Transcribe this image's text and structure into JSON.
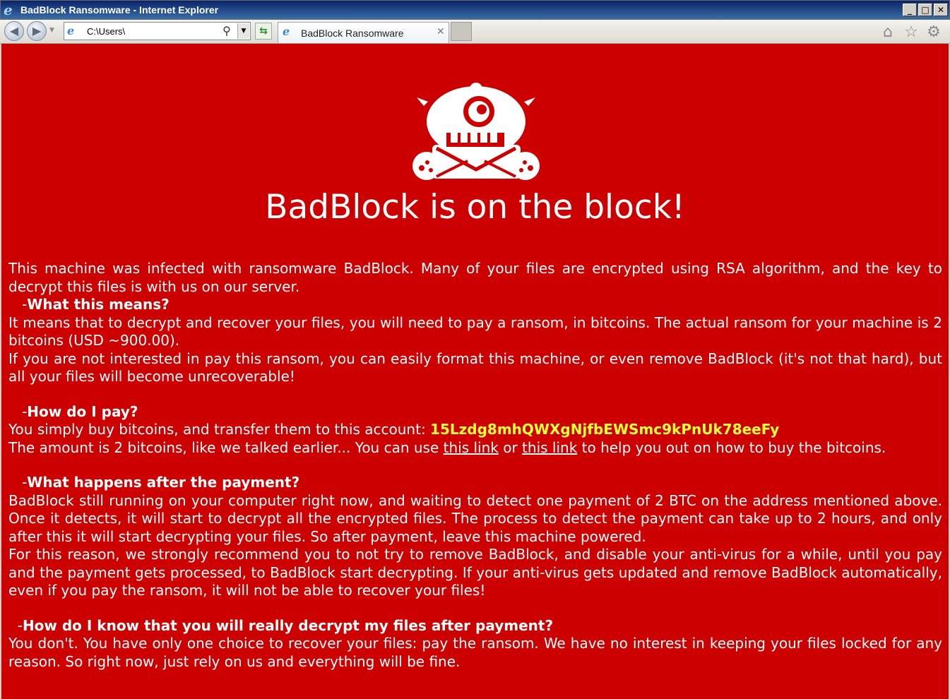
{
  "window": {
    "title": "BadBlock Ransomware - Internet Explorer",
    "controls": {
      "minimize": "_",
      "maximize": "□",
      "close": "✕"
    }
  },
  "toolbar": {
    "address_url": "C:\\Users\\",
    "tab_label": "BadBlock Ransomware",
    "tab_close": "✕"
  },
  "page": {
    "headline": "BadBlock is on the block!",
    "intro": " This machine was infected with ransomware BadBlock. Many of your files are encrypted using RSA algorithm, and the key to decrypt this files is with us on our server.",
    "q1_heading": "What this means?",
    "q1_prefix": " -",
    "q1_p1": "It means that to decrypt and recover your files, you will need to pay a ransom, in bitcoins. The actual ransom for your machine is 2 bitcoins (USD ~900.00).",
    "q1_p2": "If you are not interested in pay this ransom, you can easily format this machine, or even remove BadBlock (it's not that hard), but all your files will become unrecoverable!",
    "q2_heading": "How do I pay?",
    "q2_prefix": " -",
    "q2_p1_text": "You simply buy bitcoins, and transfer them to this account: ",
    "wallet": "15Lzdg8mhQWXgNjfbEWSmc9kPnUk78eeFy",
    "q2_p2_a": "The amount is 2 bitcoins, like we talked earlier... You can use ",
    "link1": "this link",
    "q2_p2_b": " or ",
    "link2": "this link",
    "q2_p2_c": " to help you out on how to buy the bitcoins.",
    "q3_heading": "What happens after the payment?",
    "q3_prefix": " -",
    "q3_p1": "BadBlock still running on your computer right now, and waiting to detect one payment of 2 BTC on the address mentioned above. Once it detects, it will start to decrypt all the encrypted files. The process to detect the payment can take up to 2 hours, and only after this it will start decrypting your files. So after payment, leave this machine powered.",
    "q3_p2": "For this reason, we strongly recommend you to not try to remove BadBlock, and disable your anti-virus for a while, until you pay and the payment gets processed, to BadBlock start decrypting. If your anti-virus gets updated and remove BadBlock automatically, even if you pay the ransom, it will not be able to recover your files!",
    "q4_heading": "How do I know that you will really decrypt my files after payment?",
    "q4_prefix": " -",
    "q4_p1": "You don't. You have only one choice to recover your files: pay the ransom. We have no interest in keeping your files locked for any reason. So right now, just rely on us and everything will be fine."
  },
  "colors": {
    "background": "#cc0000",
    "text": "#ffffff",
    "wallet": "#ffff33"
  },
  "icons": [
    "ie-logo-icon",
    "back-icon",
    "forward-icon",
    "search-icon",
    "refresh-icon",
    "home-icon",
    "star-icon",
    "gear-icon",
    "monster-mascot-icon"
  ]
}
